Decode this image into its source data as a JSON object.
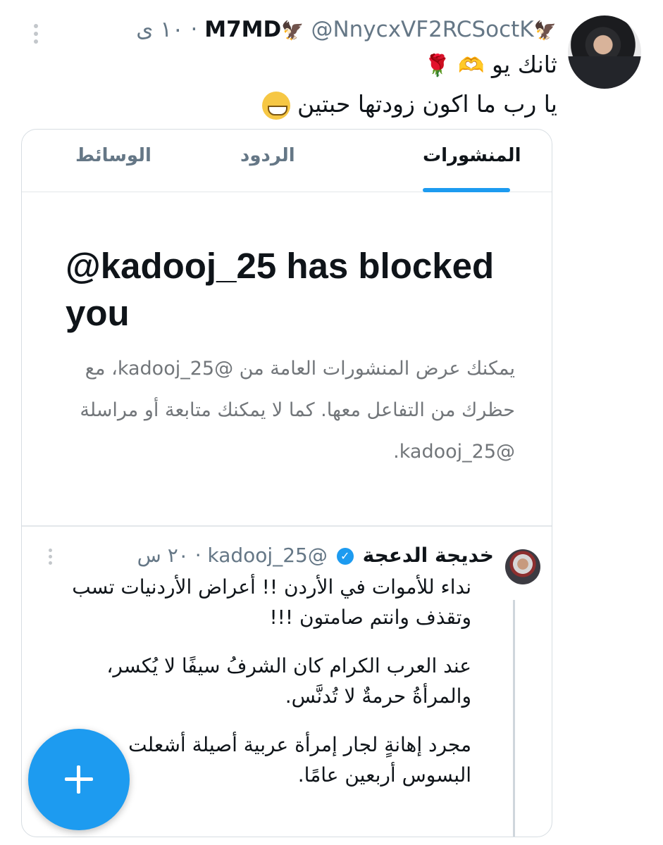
{
  "outer_tweet": {
    "author_name": "M7MD",
    "handle": "@NnycxVF2RCSoctK",
    "separator": "·",
    "time": "١٠ ى",
    "line1": "ثانك يو",
    "line2": "يا رب ما اكون زودتها حبتين"
  },
  "tabs": {
    "posts": "المنشورات",
    "replies": "الردود",
    "media": "الوسائط"
  },
  "blocked": {
    "title": "@kadooj_25 has blocked you",
    "description": "يمكنك عرض المنشورات العامة من @kadooj_25، مع حظرك من التفاعل معها. كما لا يمكنك متابعة أو مراسلة @kadooj_25."
  },
  "inner_tweet": {
    "author_name": "خديجة الدعجة",
    "handle": "@kadooj_25",
    "separator": "·",
    "time": "٢٠ س",
    "paragraph1": "نداء للأموات في الأردن !! أعراض الأردنيات تسب وتقذف وانتم صامتون !!!",
    "paragraph2": "عند العرب الكرام كان الشرفُ سيفًا لا يُكسر، والمرأةُ حرمةٌ لا تُدنَّس.",
    "paragraph3": "مجرد إهانةٍ لجار إمرأة عربية أصيلة أشعلت البسوس أربعين عامًا."
  },
  "colors": {
    "accent": "#1d9bf0",
    "secondary_text": "#657786"
  }
}
